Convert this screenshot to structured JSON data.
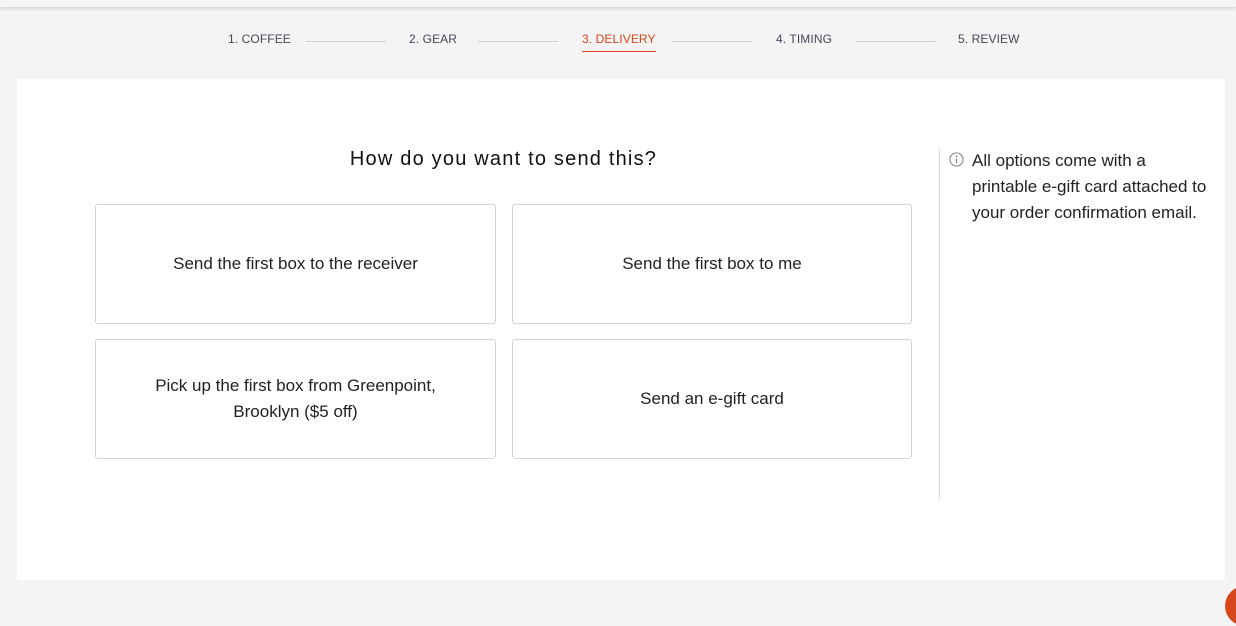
{
  "stepper": {
    "steps": [
      {
        "label": "1. COFFEE"
      },
      {
        "label": "2. GEAR"
      },
      {
        "label": "3. DELIVERY"
      },
      {
        "label": "4. TIMING"
      },
      {
        "label": "5. REVIEW"
      }
    ],
    "active_index": 2
  },
  "main": {
    "question": "How do you want to send this?",
    "options": [
      {
        "label": "Send the first box to the receiver"
      },
      {
        "label": "Send the first box to me"
      },
      {
        "label": "Pick up the first box from Greenpoint, Brooklyn ($5 off)"
      },
      {
        "label": "Send an e-gift card"
      }
    ]
  },
  "info": {
    "icon": "info-icon",
    "text": "All options come with a printable e-gift card attached to your order confirmation email."
  },
  "colors": {
    "accent": "#d6461a",
    "border": "#d4d4d4",
    "page_background": "#f4f4f4"
  }
}
